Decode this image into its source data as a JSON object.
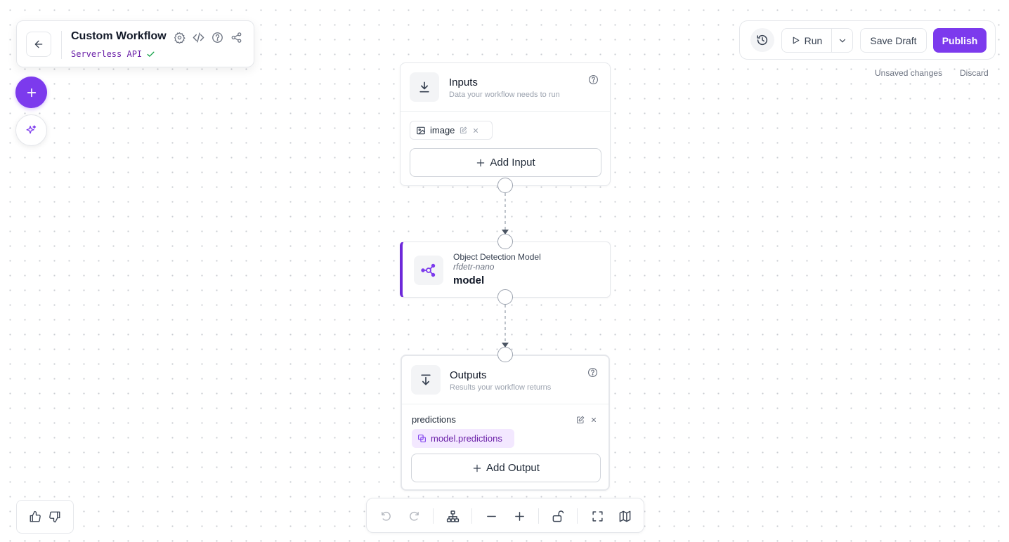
{
  "header": {
    "title": "Custom Workflow",
    "subtitle": "Serverless API",
    "icons": [
      "settings-icon",
      "code-icon",
      "help-icon",
      "share-icon"
    ]
  },
  "left_actions": [
    "add-block-icon",
    "ai-sparkle-icon"
  ],
  "toolbar": {
    "history_icon": "history-icon",
    "run_label": "Run",
    "save_draft_label": "Save Draft",
    "publish_label": "Publish",
    "unsaved_text": "Unsaved changes",
    "discard_label": "Discard"
  },
  "nodes": {
    "inputs": {
      "title": "Inputs",
      "description": "Data your workflow needs to run",
      "items": [
        {
          "name": "image",
          "icon": "image-icon"
        }
      ],
      "add_label": "Add Input"
    },
    "model": {
      "type": "Object Detection Model",
      "variant": "rfdetr-nano",
      "name": "model"
    },
    "outputs": {
      "title": "Outputs",
      "description": "Results your workflow returns",
      "items": [
        {
          "name": "predictions",
          "value": "model.predictions"
        }
      ],
      "add_label": "Add Output"
    }
  },
  "colors": {
    "accent": "#7c3aed",
    "accent_dark": "#6d28d9",
    "chip_bg": "#f3e8ff",
    "chip_text": "#6b21a8",
    "success": "#16a34a"
  },
  "bottom_controls": [
    "undo-icon",
    "redo-icon",
    "auto-layout-icon",
    "zoom-out-icon",
    "zoom-in-icon",
    "lock-icon",
    "fit-view-icon",
    "minimap-icon"
  ],
  "feedback": [
    "thumbs-up-icon",
    "thumbs-down-icon"
  ]
}
